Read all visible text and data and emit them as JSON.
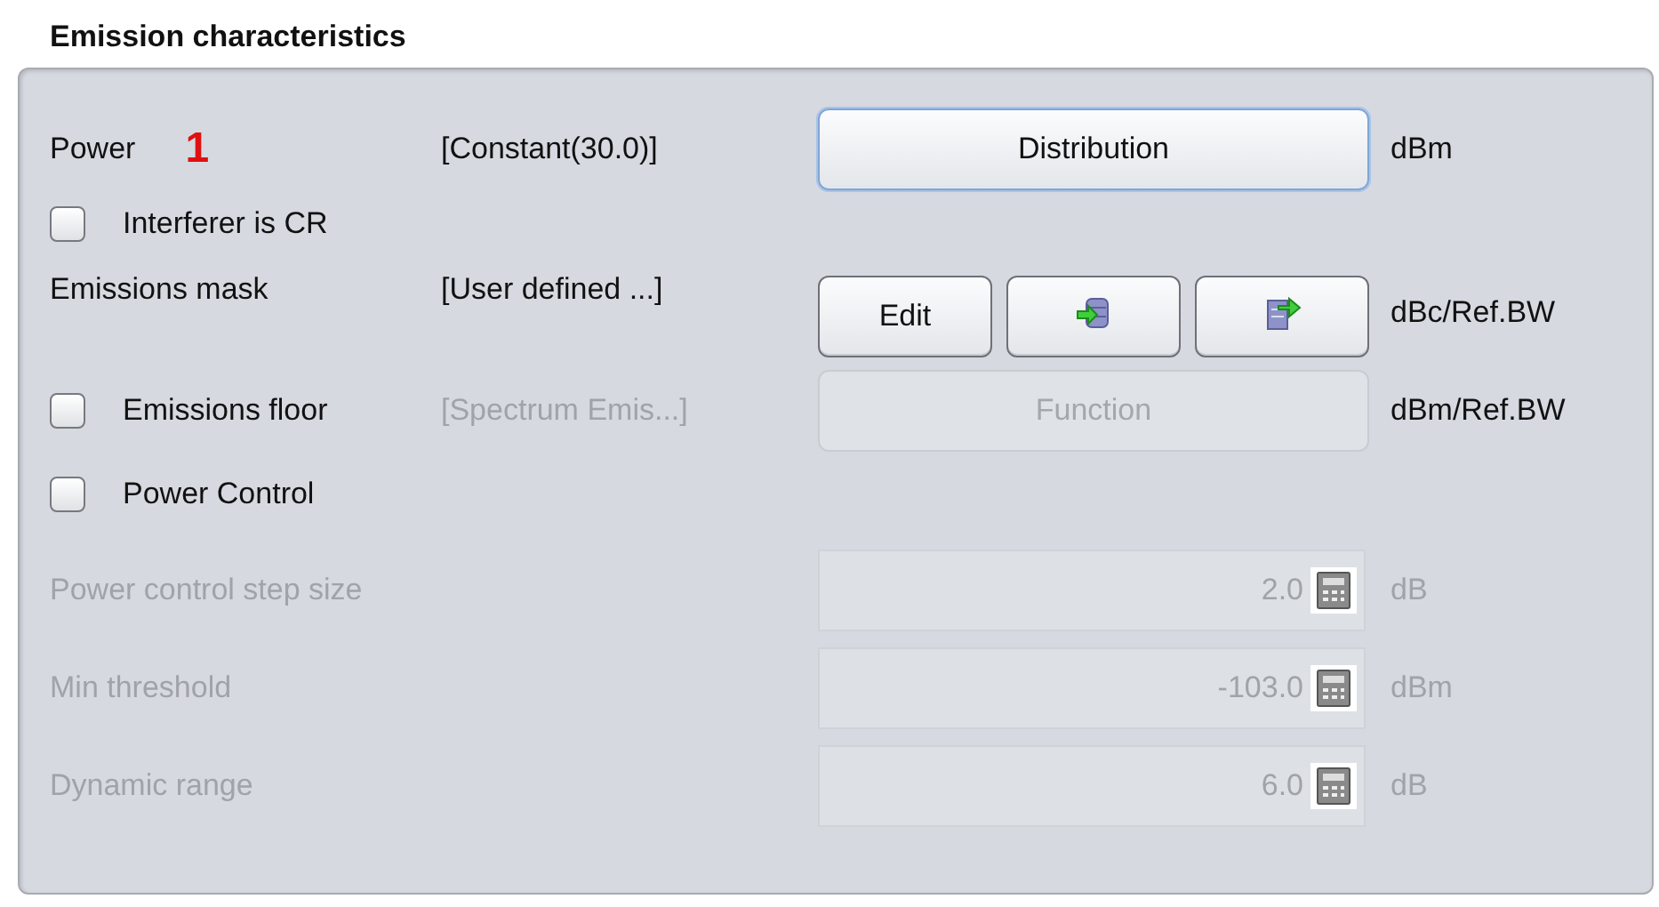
{
  "section": {
    "title": "Emission characteristics"
  },
  "power": {
    "label": "Power",
    "marker": "1",
    "value": "[Constant(30.0)]",
    "button": "Distribution",
    "focused": true,
    "unit": "dBm"
  },
  "interferer_is_cr": {
    "label": "Interferer is CR",
    "checked": false
  },
  "emissions_mask": {
    "label": "Emissions mask",
    "value": "[User defined ...]",
    "buttons": [
      {
        "kind": "text",
        "label": "Edit"
      },
      {
        "kind": "import"
      },
      {
        "kind": "export"
      }
    ],
    "unit": "dBc/Ref.BW"
  },
  "emissions_floor": {
    "label": "Emissions floor",
    "checked": false,
    "value": "[Spectrum Emis...]",
    "button": "Function",
    "disabled": true,
    "unit": "dBm/Ref.BW"
  },
  "power_control": {
    "label": "Power Control",
    "checked": false
  },
  "parameters": [
    {
      "label": "Power control step size",
      "value": "2.0",
      "unit": "dB",
      "disabled": true
    },
    {
      "label": "Min threshold",
      "value": "-103.0",
      "unit": "dBm",
      "disabled": true
    },
    {
      "label": "Dynamic range",
      "value": "6.0",
      "unit": "dB",
      "disabled": true
    }
  ]
}
